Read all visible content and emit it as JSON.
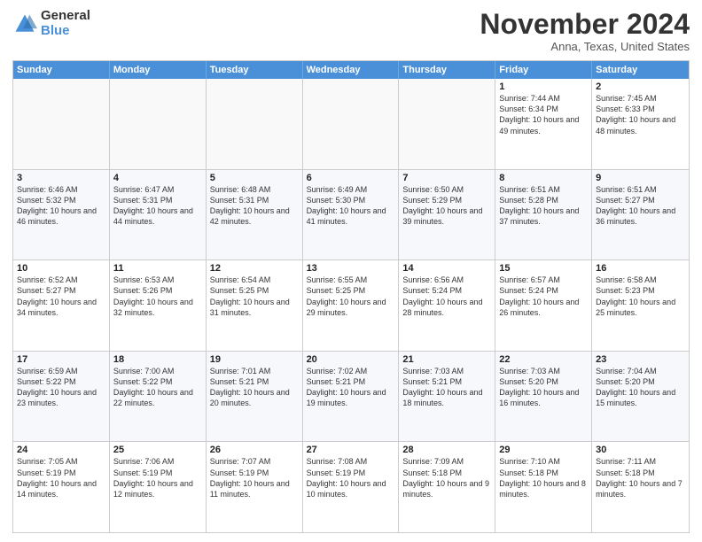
{
  "logo": {
    "general": "General",
    "blue": "Blue"
  },
  "header": {
    "month": "November 2024",
    "location": "Anna, Texas, United States"
  },
  "weekdays": [
    "Sunday",
    "Monday",
    "Tuesday",
    "Wednesday",
    "Thursday",
    "Friday",
    "Saturday"
  ],
  "rows": [
    [
      {
        "day": "",
        "empty": true
      },
      {
        "day": "",
        "empty": true
      },
      {
        "day": "",
        "empty": true
      },
      {
        "day": "",
        "empty": true
      },
      {
        "day": "",
        "empty": true
      },
      {
        "day": "1",
        "sunrise": "Sunrise: 7:44 AM",
        "sunset": "Sunset: 6:34 PM",
        "daylight": "Daylight: 10 hours and 49 minutes."
      },
      {
        "day": "2",
        "sunrise": "Sunrise: 7:45 AM",
        "sunset": "Sunset: 6:33 PM",
        "daylight": "Daylight: 10 hours and 48 minutes."
      }
    ],
    [
      {
        "day": "3",
        "sunrise": "Sunrise: 6:46 AM",
        "sunset": "Sunset: 5:32 PM",
        "daylight": "Daylight: 10 hours and 46 minutes."
      },
      {
        "day": "4",
        "sunrise": "Sunrise: 6:47 AM",
        "sunset": "Sunset: 5:31 PM",
        "daylight": "Daylight: 10 hours and 44 minutes."
      },
      {
        "day": "5",
        "sunrise": "Sunrise: 6:48 AM",
        "sunset": "Sunset: 5:31 PM",
        "daylight": "Daylight: 10 hours and 42 minutes."
      },
      {
        "day": "6",
        "sunrise": "Sunrise: 6:49 AM",
        "sunset": "Sunset: 5:30 PM",
        "daylight": "Daylight: 10 hours and 41 minutes."
      },
      {
        "day": "7",
        "sunrise": "Sunrise: 6:50 AM",
        "sunset": "Sunset: 5:29 PM",
        "daylight": "Daylight: 10 hours and 39 minutes."
      },
      {
        "day": "8",
        "sunrise": "Sunrise: 6:51 AM",
        "sunset": "Sunset: 5:28 PM",
        "daylight": "Daylight: 10 hours and 37 minutes."
      },
      {
        "day": "9",
        "sunrise": "Sunrise: 6:51 AM",
        "sunset": "Sunset: 5:27 PM",
        "daylight": "Daylight: 10 hours and 36 minutes."
      }
    ],
    [
      {
        "day": "10",
        "sunrise": "Sunrise: 6:52 AM",
        "sunset": "Sunset: 5:27 PM",
        "daylight": "Daylight: 10 hours and 34 minutes."
      },
      {
        "day": "11",
        "sunrise": "Sunrise: 6:53 AM",
        "sunset": "Sunset: 5:26 PM",
        "daylight": "Daylight: 10 hours and 32 minutes."
      },
      {
        "day": "12",
        "sunrise": "Sunrise: 6:54 AM",
        "sunset": "Sunset: 5:25 PM",
        "daylight": "Daylight: 10 hours and 31 minutes."
      },
      {
        "day": "13",
        "sunrise": "Sunrise: 6:55 AM",
        "sunset": "Sunset: 5:25 PM",
        "daylight": "Daylight: 10 hours and 29 minutes."
      },
      {
        "day": "14",
        "sunrise": "Sunrise: 6:56 AM",
        "sunset": "Sunset: 5:24 PM",
        "daylight": "Daylight: 10 hours and 28 minutes."
      },
      {
        "day": "15",
        "sunrise": "Sunrise: 6:57 AM",
        "sunset": "Sunset: 5:24 PM",
        "daylight": "Daylight: 10 hours and 26 minutes."
      },
      {
        "day": "16",
        "sunrise": "Sunrise: 6:58 AM",
        "sunset": "Sunset: 5:23 PM",
        "daylight": "Daylight: 10 hours and 25 minutes."
      }
    ],
    [
      {
        "day": "17",
        "sunrise": "Sunrise: 6:59 AM",
        "sunset": "Sunset: 5:22 PM",
        "daylight": "Daylight: 10 hours and 23 minutes."
      },
      {
        "day": "18",
        "sunrise": "Sunrise: 7:00 AM",
        "sunset": "Sunset: 5:22 PM",
        "daylight": "Daylight: 10 hours and 22 minutes."
      },
      {
        "day": "19",
        "sunrise": "Sunrise: 7:01 AM",
        "sunset": "Sunset: 5:21 PM",
        "daylight": "Daylight: 10 hours and 20 minutes."
      },
      {
        "day": "20",
        "sunrise": "Sunrise: 7:02 AM",
        "sunset": "Sunset: 5:21 PM",
        "daylight": "Daylight: 10 hours and 19 minutes."
      },
      {
        "day": "21",
        "sunrise": "Sunrise: 7:03 AM",
        "sunset": "Sunset: 5:21 PM",
        "daylight": "Daylight: 10 hours and 18 minutes."
      },
      {
        "day": "22",
        "sunrise": "Sunrise: 7:03 AM",
        "sunset": "Sunset: 5:20 PM",
        "daylight": "Daylight: 10 hours and 16 minutes."
      },
      {
        "day": "23",
        "sunrise": "Sunrise: 7:04 AM",
        "sunset": "Sunset: 5:20 PM",
        "daylight": "Daylight: 10 hours and 15 minutes."
      }
    ],
    [
      {
        "day": "24",
        "sunrise": "Sunrise: 7:05 AM",
        "sunset": "Sunset: 5:19 PM",
        "daylight": "Daylight: 10 hours and 14 minutes."
      },
      {
        "day": "25",
        "sunrise": "Sunrise: 7:06 AM",
        "sunset": "Sunset: 5:19 PM",
        "daylight": "Daylight: 10 hours and 12 minutes."
      },
      {
        "day": "26",
        "sunrise": "Sunrise: 7:07 AM",
        "sunset": "Sunset: 5:19 PM",
        "daylight": "Daylight: 10 hours and 11 minutes."
      },
      {
        "day": "27",
        "sunrise": "Sunrise: 7:08 AM",
        "sunset": "Sunset: 5:19 PM",
        "daylight": "Daylight: 10 hours and 10 minutes."
      },
      {
        "day": "28",
        "sunrise": "Sunrise: 7:09 AM",
        "sunset": "Sunset: 5:18 PM",
        "daylight": "Daylight: 10 hours and 9 minutes."
      },
      {
        "day": "29",
        "sunrise": "Sunrise: 7:10 AM",
        "sunset": "Sunset: 5:18 PM",
        "daylight": "Daylight: 10 hours and 8 minutes."
      },
      {
        "day": "30",
        "sunrise": "Sunrise: 7:11 AM",
        "sunset": "Sunset: 5:18 PM",
        "daylight": "Daylight: 10 hours and 7 minutes."
      }
    ]
  ]
}
